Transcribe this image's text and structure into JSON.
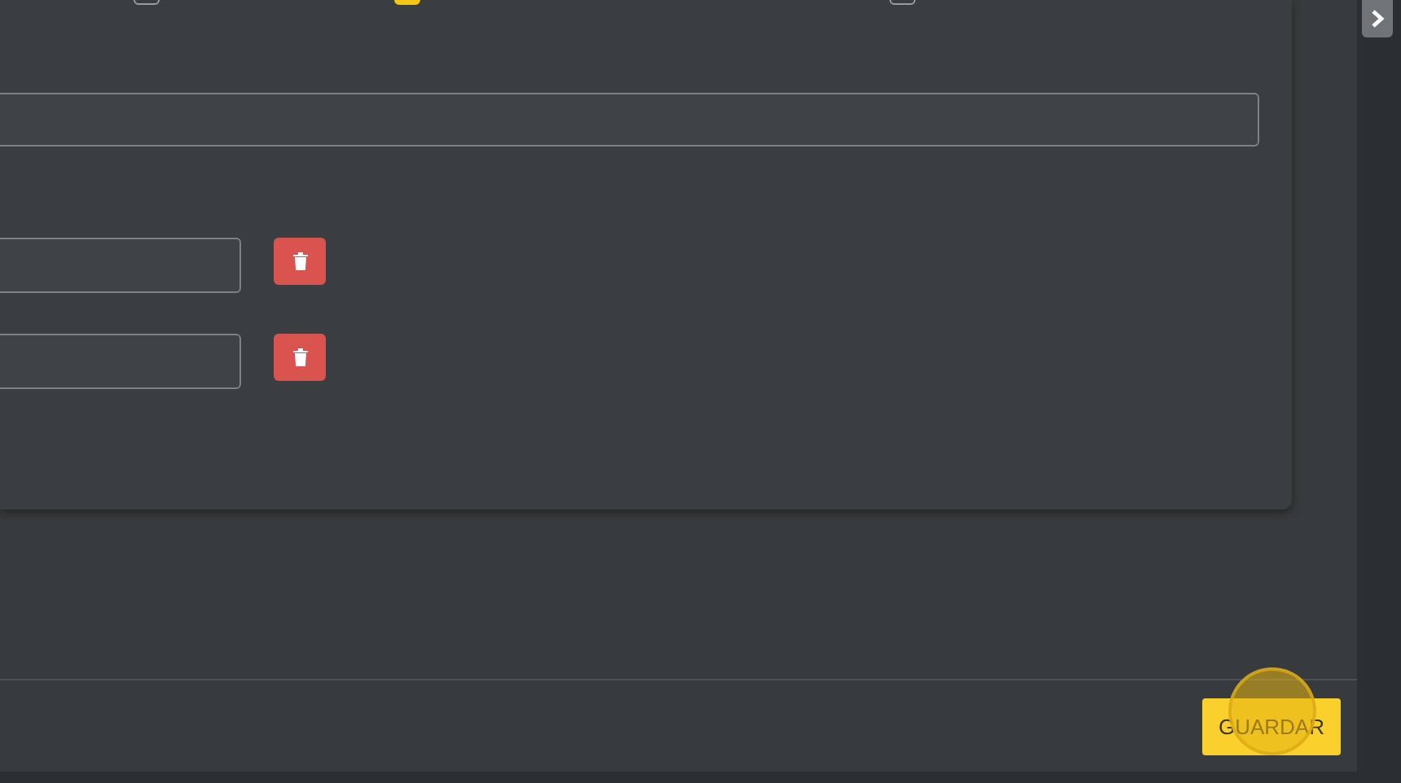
{
  "options": [
    {
      "checked": false
    },
    {
      "checked": true
    },
    {
      "checked": false
    }
  ],
  "items": [
    {
      "kind": "field"
    },
    {
      "kind": "field"
    }
  ],
  "save_button": {
    "label": "GUARDAR"
  }
}
